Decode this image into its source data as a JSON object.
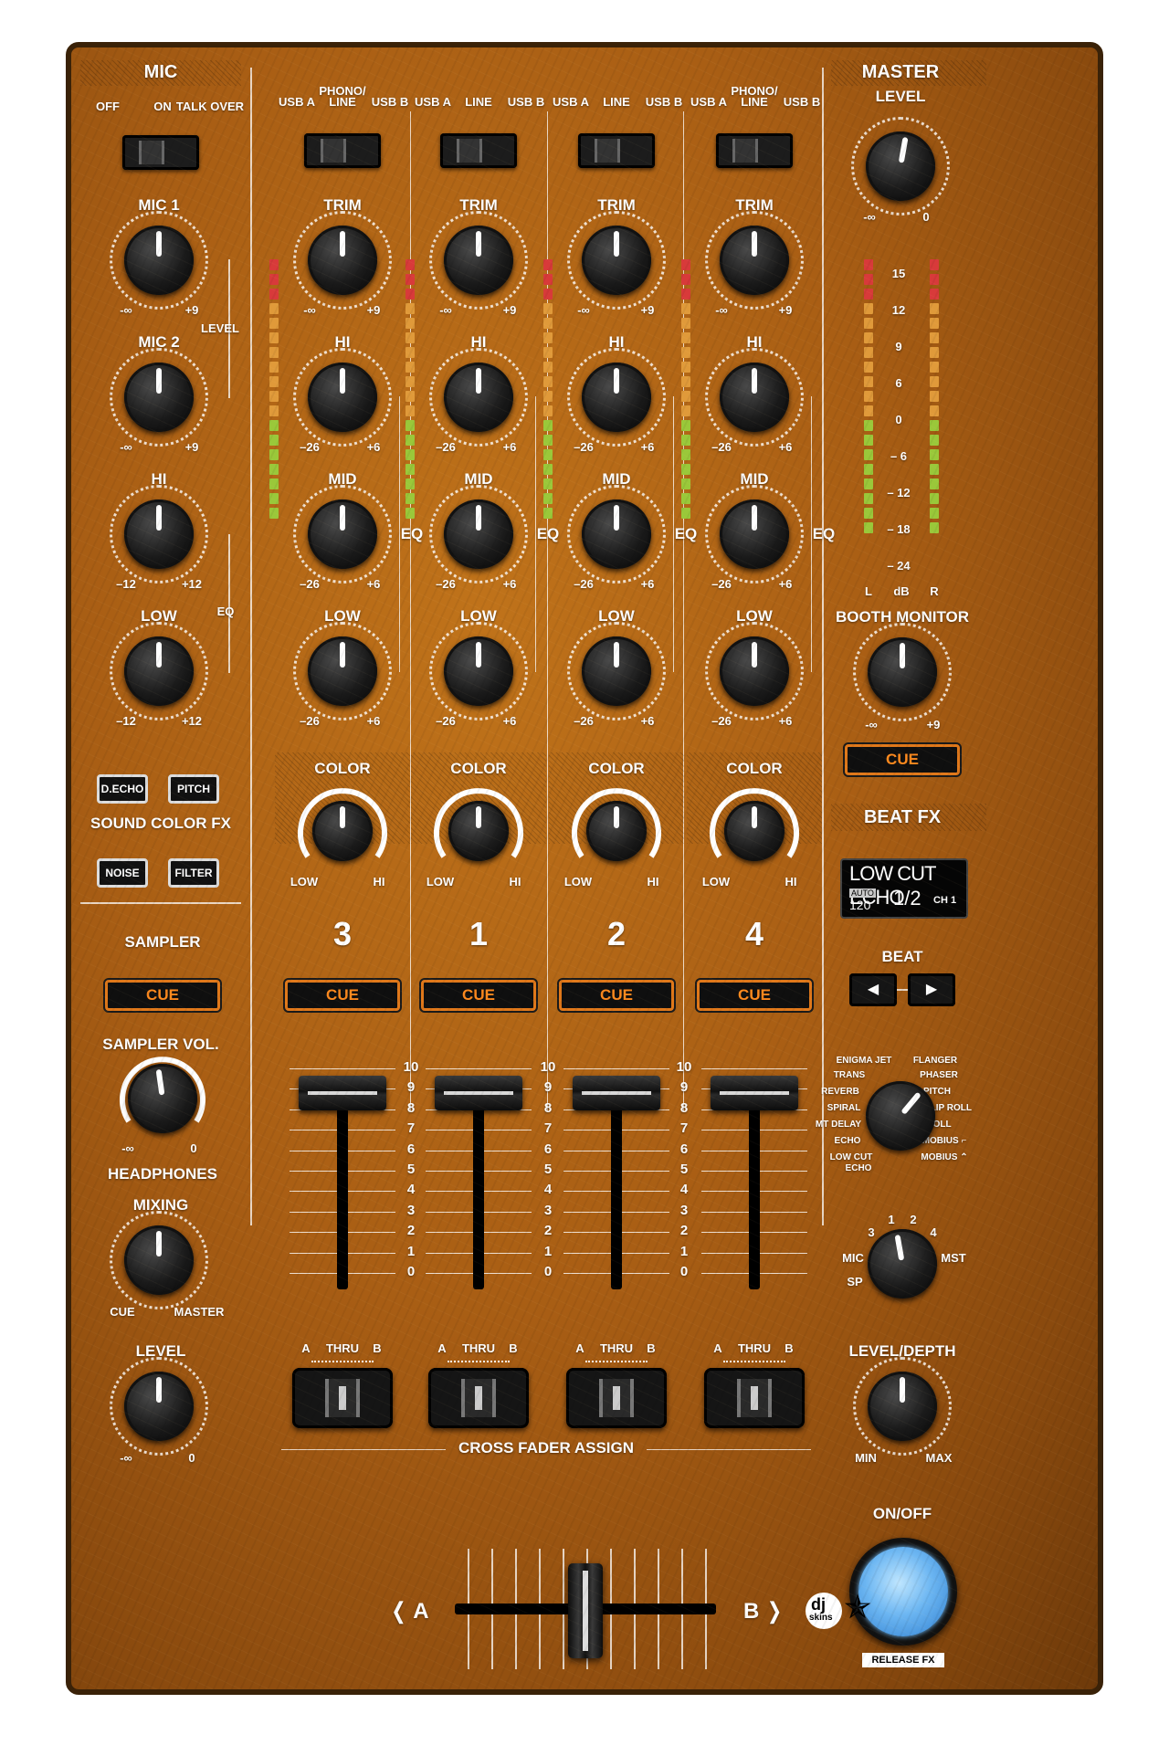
{
  "mic": {
    "title": "MIC",
    "switch_off": "OFF",
    "switch_on": "ON",
    "switch_talkover": "TALK OVER",
    "mic1": "MIC 1",
    "mic2": "MIC 2",
    "level": "LEVEL",
    "hi": "HI",
    "low": "LOW",
    "eq": "EQ",
    "min_inf": "-∞",
    "plus9": "+9",
    "minus12": "–12",
    "plus12": "+12"
  },
  "sound_color_fx": {
    "title": "SOUND COLOR FX",
    "buttons": [
      "D.ECHO",
      "PITCH",
      "NOISE",
      "FILTER"
    ]
  },
  "sampler": {
    "title": "SAMPLER",
    "cue": "CUE",
    "vol": "SAMPLER VOL.",
    "min": "-∞",
    "max": "0"
  },
  "headphones": {
    "title": "HEADPHONES",
    "mixing": "MIXING",
    "cue": "CUE",
    "master": "MASTER",
    "level": "LEVEL",
    "min": "-∞",
    "max": "0"
  },
  "channels": [
    {
      "number": "3",
      "src_a": "USB A",
      "src_mid_1": "PHONO/",
      "src_mid_2": "LINE",
      "src_b": "USB B"
    },
    {
      "number": "1",
      "src_a": "USB A",
      "src_mid_1": "",
      "src_mid_2": "LINE",
      "src_b": "USB B"
    },
    {
      "number": "2",
      "src_a": "USB A",
      "src_mid_1": "",
      "src_mid_2": "LINE",
      "src_b": "USB B"
    },
    {
      "number": "4",
      "src_a": "USB A",
      "src_mid_1": "PHONO/",
      "src_mid_2": "LINE",
      "src_b": "USB B"
    }
  ],
  "channel_labels": {
    "trim": "TRIM",
    "hi": "HI",
    "mid": "MID",
    "low": "LOW",
    "eq": "EQ",
    "color": "COLOR",
    "color_low": "LOW",
    "color_hi": "HI",
    "cue": "CUE",
    "trim_min": "-∞",
    "trim_max": "+9",
    "eq_min": "–26",
    "eq_max": "+6",
    "assign_a": "A",
    "assign_thru": "THRU",
    "assign_b": "B"
  },
  "fader_scale": [
    "10",
    "9",
    "8",
    "7",
    "6",
    "5",
    "4",
    "3",
    "2",
    "1",
    "0"
  ],
  "cross_fader_assign": "CROSS FADER ASSIGN",
  "crossfader": {
    "a": "❬ A",
    "b": "B ❭"
  },
  "master": {
    "title": "MASTER",
    "level": "LEVEL",
    "min": "-∞",
    "max": "0",
    "meter_scale": [
      "15",
      "12",
      "9",
      "6",
      "0",
      "– 6",
      "– 12",
      "– 18",
      "– 24"
    ],
    "meter_l": "L",
    "meter_db": "dB",
    "meter_r": "R"
  },
  "booth": {
    "title": "BOOTH MONITOR",
    "min": "-∞",
    "max": "+9",
    "cue": "CUE"
  },
  "beat_fx": {
    "title": "BEAT FX",
    "display_effect": "LOW CUT ECHO",
    "display_auto": "AUTO",
    "display_bpm": "120",
    "display_beat": "1/2",
    "display_ch": "CH 1",
    "beat": "BEAT",
    "left": "◀",
    "right": "▶",
    "effects_left": [
      "ENIGMA JET",
      "TRANS",
      "REVERB",
      "SPIRAL",
      "MT DELAY",
      "ECHO",
      "LOW CUT",
      "ECHO"
    ],
    "effects_right": [
      "FLANGER",
      "PHASER",
      "PITCH",
      "SLIP ROLL",
      "ROLL",
      "MOBIUS ⌐",
      "MOBIUS ⌃"
    ],
    "ch_mic": "MIC",
    "ch_sp": "SP",
    "ch_3": "3",
    "ch_1": "1",
    "ch_2": "2",
    "ch_4": "4",
    "ch_mst": "MST",
    "level_depth": "LEVEL/DEPTH",
    "min": "MIN",
    "max": "MAX",
    "on_off": "ON/OFF",
    "release": "RELEASE FX"
  },
  "logo": {
    "text_1": "dj",
    "text_2": "skins"
  }
}
